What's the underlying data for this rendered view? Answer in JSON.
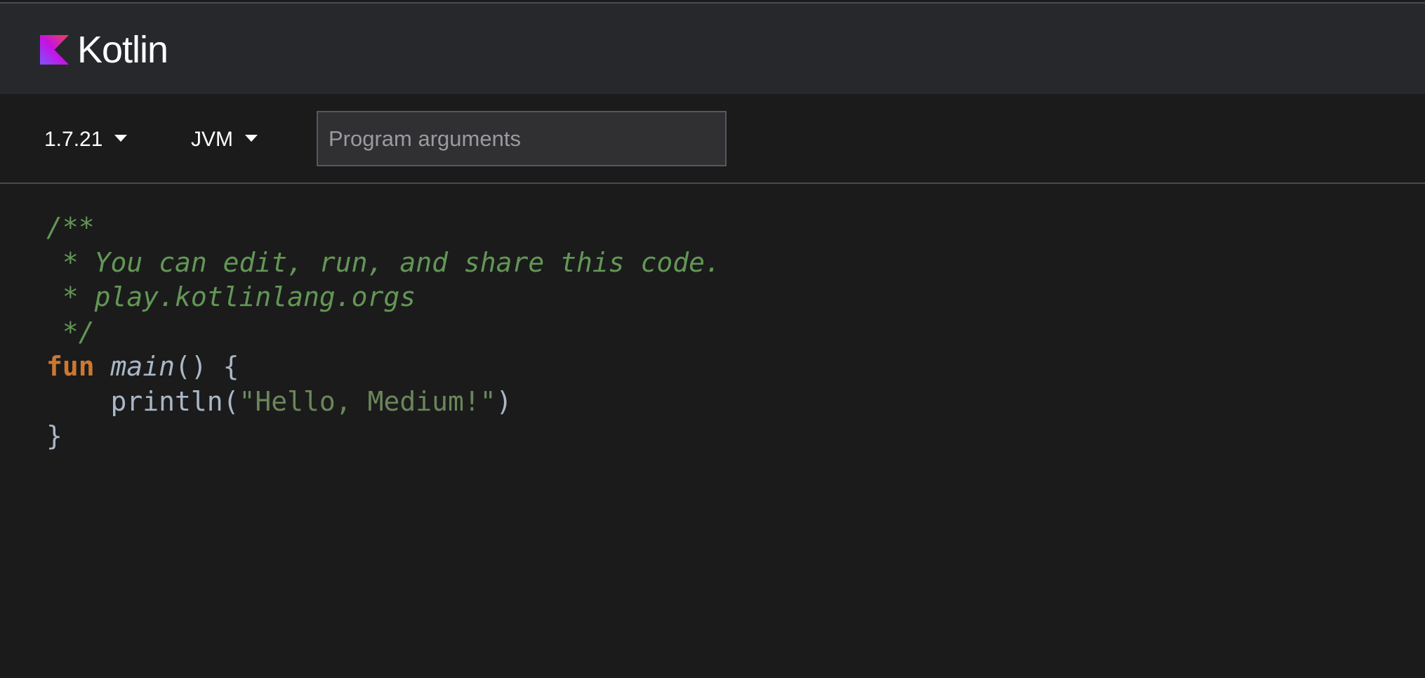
{
  "header": {
    "logo_text": "Kotlin",
    "logo_icon": "kotlin-logo-icon"
  },
  "toolbar": {
    "version": "1.7.21",
    "target": "JVM",
    "args_placeholder": "Program arguments",
    "args_value": ""
  },
  "editor": {
    "lines": [
      [
        {
          "t": "comment",
          "v": "/**"
        }
      ],
      [
        {
          "t": "comment",
          "v": " * You can edit, run, and share this code."
        }
      ],
      [
        {
          "t": "comment",
          "v": " * play.kotlinlang.orgs"
        }
      ],
      [
        {
          "t": "comment",
          "v": " */"
        }
      ],
      [
        {
          "t": "keyword",
          "v": "fun"
        },
        {
          "t": "plain",
          "v": " "
        },
        {
          "t": "fn",
          "v": "main"
        },
        {
          "t": "plain",
          "v": "() {"
        }
      ],
      [
        {
          "t": "plain",
          "v": "    println("
        },
        {
          "t": "string",
          "v": "\"Hello, Medium!\""
        },
        {
          "t": "plain",
          "v": ")"
        }
      ],
      [
        {
          "t": "plain",
          "v": "}"
        }
      ]
    ]
  },
  "colors": {
    "background": "#1b1b1c",
    "header_bg": "#27282c",
    "comment": "#629755",
    "keyword": "#cc7832",
    "string": "#6a8759",
    "plain": "#a9b7c6"
  }
}
